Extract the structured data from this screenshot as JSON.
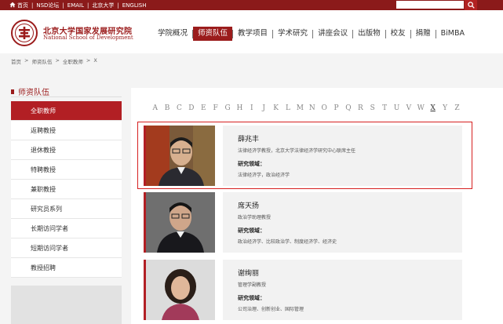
{
  "topbar": {
    "links": [
      "首页",
      "NSD论坛",
      "EMAIL",
      "北京大学",
      "ENGLISH"
    ],
    "search_placeholder": ""
  },
  "header": {
    "logo_cn": "北京大学国家发展研究院",
    "logo_en": "National School of Development",
    "nav": [
      "学院概况",
      "师资队伍",
      "教学项目",
      "学术研究",
      "讲座会议",
      "出版物",
      "校友",
      "捐赠",
      "BiMBA"
    ],
    "nav_active": "师资队伍"
  },
  "breadcrumb": [
    "首页",
    ">",
    "师资队伍",
    ">",
    "全职教师",
    ">",
    "X"
  ],
  "sidebar": {
    "title": "师资队伍",
    "items": [
      "全职教师",
      "返聘教授",
      "退休教授",
      "特聘教授",
      "兼职教授",
      "研究员系列",
      "长期访问学者",
      "短期访问学者",
      "教授招聘"
    ],
    "active": "全职教师"
  },
  "alphabet": [
    "A",
    "B",
    "C",
    "D",
    "E",
    "F",
    "G",
    "H",
    "I",
    "J",
    "K",
    "L",
    "M",
    "N",
    "O",
    "P",
    "Q",
    "R",
    "S",
    "T",
    "U",
    "V",
    "W",
    "X",
    "Y",
    "Z"
  ],
  "alphabet_selected": "X",
  "faculty": [
    {
      "name": "薛兆丰",
      "title": "法律经济学教授，北京大学法律经济学研究中心联席主任",
      "field_label": "研究领域：",
      "field": "法律经济学，政治经济学"
    },
    {
      "name": "席天扬",
      "title": "政治学助理教授",
      "field_label": "研究领域：",
      "field": "政治经济学、比较政治学、制度经济学、经济史"
    },
    {
      "name": "谢绚丽",
      "title": "管理学副教授",
      "field_label": "研究领域：",
      "field": "公司治理、创新创业、国际管理"
    }
  ],
  "colors": {
    "brand": "#9b1c1c",
    "accent": "#b21f24",
    "highlight": "#d62020"
  }
}
